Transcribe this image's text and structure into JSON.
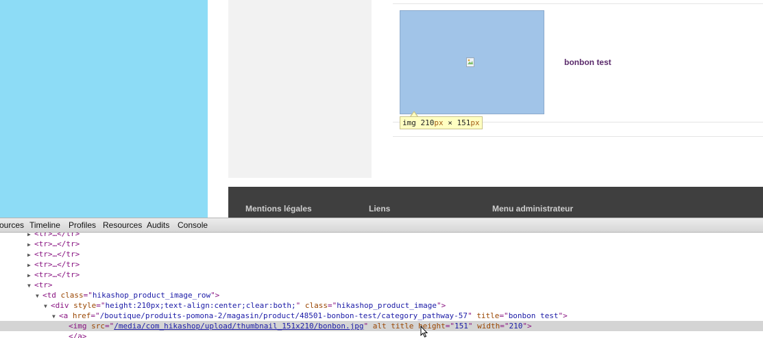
{
  "product": {
    "title": "bonbon test",
    "image_alt": "broken-image-icon"
  },
  "tooltip": {
    "tag": "img",
    "width": "210",
    "height": "151",
    "unit": "px",
    "sep": "×"
  },
  "footer": {
    "links": [
      "Mentions légales",
      "Liens",
      "Menu administrateur"
    ]
  },
  "devtools": {
    "tabs": [
      "ources",
      "Timeline",
      "Profiles",
      "Resources",
      "Audits",
      "Console"
    ],
    "tree": {
      "collapsed_row": "<tr>…</tr>",
      "tr_open": "<tr>",
      "td": {
        "tag": "td",
        "attr": "class",
        "value": "hikashop_product_image_row"
      },
      "div": {
        "tag": "div",
        "attr1": "style",
        "value1": "height:210px;text-align:center;clear:both;",
        "attr2": "class",
        "value2": "hikashop_product_image"
      },
      "a": {
        "tag": "a",
        "attr1": "href",
        "value1": "/boutique/produits-pomona-2/magasin/product/48501-bonbon-test/category_pathway-57",
        "attr2": "title",
        "value2": "bonbon test"
      },
      "img": {
        "tag": "img",
        "attr1": "src",
        "value1": "/media/com_hikashop/upload/thumbnail_151x210/bonbon.jpg",
        "attr2": "alt",
        "attr3": "title",
        "attr4": "height",
        "value4": "151",
        "attr5": "width",
        "value5": "210"
      },
      "a_close": "</a>"
    }
  }
}
